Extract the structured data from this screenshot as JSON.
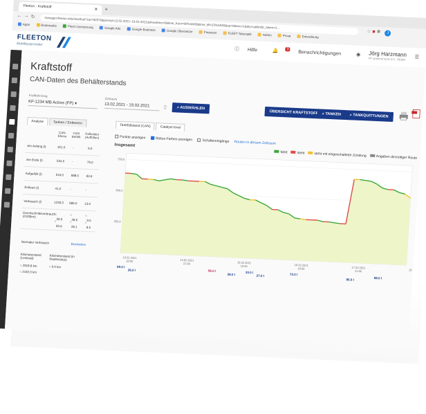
{
  "browser": {
    "tab_title": "Fleeton - Kraftstoff",
    "url": "manager.fleeton.info/new/fuel?car=92579&period=13.02.2021~19.02.2021&showtime=0&time_from=00%3A00&time_till=23%3A59&ep=0&exc=1&dty=cal&refp_token=2...",
    "bookmarks": [
      "Apps",
      "Bookmarks",
      "Fleet Lizenzierung",
      "Google Ads",
      "Google Business",
      "Google Übersetzer",
      "Finanzen",
      "FLEET Telematik",
      "Admin",
      "Privat",
      "Entwicklung"
    ]
  },
  "app": {
    "brand": "FLEETON",
    "brand_sub": "Mobilitysprovider",
    "help_label": "Hilfe",
    "notifications_label": "Benachrichtigungen",
    "notifications_count": "3",
    "user_name": "Jörg Harzmann",
    "user_org": "PF system4 tours 4.0 · DEMO"
  },
  "page": {
    "title": "Kraftstoff",
    "subtitle": "CAN-Daten des Behälterstands"
  },
  "filters": {
    "vehicle_label": "Kraftfahrzeug",
    "vehicle_value": "KF-1234 MB Actros (FP)",
    "period_label": "Zeitraum",
    "period_value": "13.02.2021 - 19.02.2021",
    "select_button": "AUSWÄHLEN"
  },
  "actions": {
    "overview": "ÜBERSICHT KRAFTSTOFF",
    "tanken": "TANKEN",
    "quittungen": "TANKQUITTUNGEN"
  },
  "left_tabs": [
    "Analyse",
    "Tanken / Entleeren"
  ],
  "stats": {
    "headers": [
      "CAN-Ebene",
      "CAN Befüllt",
      "Kalkulator (Auffüllen)"
    ],
    "rows": [
      {
        "label": "Am Anfang (l)",
        "v1": "321.0",
        "v2": "-",
        "v3": "9.0"
      },
      {
        "label": "Am Ende (l)",
        "v1": "534.0",
        "v2": "-",
        "v3": "79.0"
      },
      {
        "label": "Aufgefüllt (l)",
        "v1": "516.0",
        "v2": "688.0",
        "v3": "83.6"
      },
      {
        "label": "Entleert (l)",
        "v1": "41.0",
        "v2": "-",
        "v3": "-"
      },
      {
        "label": "Verbrauch (l)",
        "v1": "1230.0",
        "v2": "686.0",
        "v3": "13.0"
      }
    ],
    "avg_label": "Durchschnittsverbrauch (l/100km)",
    "avg_row1": [
      "30.9",
      "28.5",
      "9.5"
    ],
    "avg_row2": [
      "50.6",
      "28.1",
      "8.5"
    ],
    "norm_label": "Normaler Verbrauch",
    "norm_link": "Bearbeiten",
    "km_label1": "Kilometerstand (Lenkrad)",
    "km_label2": "Kilometerstand (in Stadtmodus)",
    "km_val1": "2918.8 km",
    "km_val2": "2432.0 km",
    "km_val3": "0.0 km"
  },
  "chart_tabs": [
    "Tankfüllstand (CAN)",
    "Catalyst level"
  ],
  "chart_options": {
    "points": "Punkte anzeigen",
    "status_colors": "Status-Farben anzeigen",
    "switch_inputs": "Schaltereingänge",
    "routes_link": "Routen in diesem Zeitraum"
  },
  "chart_legend": [
    {
      "name": "fahrt",
      "color": "#3aa83a"
    },
    {
      "name": "steht",
      "color": "#e04a4a"
    },
    {
      "name": "steht mit eingeschalteter Zündung",
      "color": "#f2c230"
    },
    {
      "name": "Angaben derzeitiger Route",
      "color": "#888888"
    }
  ],
  "chart_data": {
    "type": "line",
    "title": "Insgesamt",
    "xlabel": "",
    "ylabel": "",
    "y_ticks": [
      "750.0",
      "500.0",
      "250.0"
    ],
    "ylim": [
      0,
      800
    ],
    "x_ticks": [
      "13.02.2021 18:00",
      "14.02.2021 21:00",
      "15.02.2021 15:00",
      "16.02.2021 18:00",
      "17.02.2021 21:00",
      "18.02.2021 15:00"
    ],
    "x": [
      0,
      2,
      4,
      6,
      8,
      10,
      12,
      14,
      16,
      18,
      20,
      22,
      24,
      26,
      28,
      30,
      32,
      34,
      36,
      38,
      40,
      42,
      44,
      46,
      48,
      50,
      52,
      54,
      56,
      58,
      60,
      62,
      64,
      66,
      68,
      70,
      72,
      74,
      76,
      78,
      80,
      82,
      84,
      86,
      88,
      90,
      92,
      94,
      96,
      98,
      100
    ],
    "series": [
      {
        "values": [
          640,
          640,
          635,
          600,
          600,
          598,
          590,
          600,
          610,
          605,
          605,
          600,
          600,
          600,
          600,
          580,
          570,
          560,
          550,
          520,
          500,
          480,
          470,
          470,
          450,
          430,
          400,
          400,
          380,
          370,
          340,
          335,
          330,
          330,
          330,
          320,
          320,
          315,
          310,
          310,
          670,
          670,
          665,
          660,
          640,
          610,
          600,
          600,
          580,
          570,
          540
        ]
      }
    ],
    "annotations": [
      "69.0 l",
      "36.0 l",
      "96.0 l",
      "38.0 l",
      "33.0 l",
      "27.0 l",
      "72.0 l",
      "86.0 l",
      "88.0 l"
    ]
  }
}
